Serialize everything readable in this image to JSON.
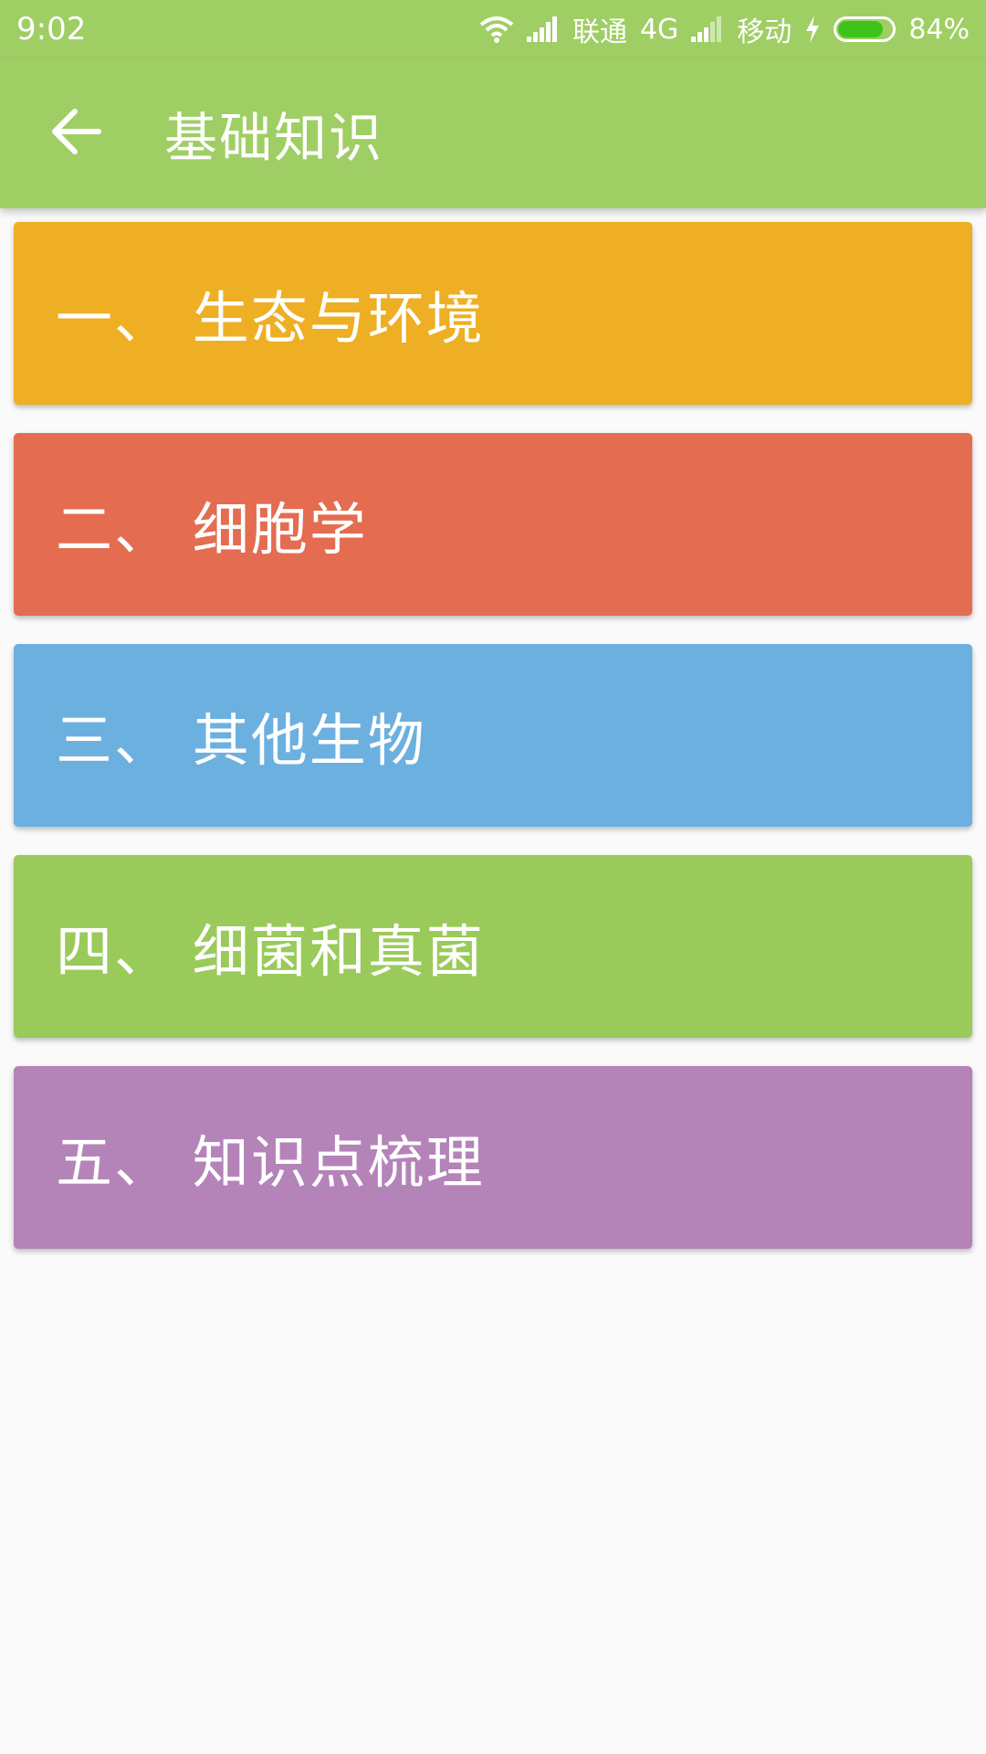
{
  "status_bar": {
    "time": "9:02",
    "carrier1": "联通",
    "network": "4G",
    "carrier2": "移动",
    "battery": "84%",
    "battery_level": 0.84,
    "wifi_icon": "wifi-icon",
    "signal_icon": "signal-icon",
    "charging_icon": "lightning-icon",
    "battery_color": "#3cc41a"
  },
  "app_bar": {
    "title": "基础知识",
    "back_icon": "arrow-left-icon",
    "color": "#9fce64"
  },
  "cards": [
    {
      "label": "一、 生态与环境",
      "color": "#eeaf24"
    },
    {
      "label": "二、 细胞学",
      "color": "#e46c51"
    },
    {
      "label": "三、 其他生物",
      "color": "#6cb0e0"
    },
    {
      "label": "四、 细菌和真菌",
      "color": "#9aca5a"
    },
    {
      "label": "五、 知识点梳理",
      "color": "#b483b8"
    }
  ]
}
